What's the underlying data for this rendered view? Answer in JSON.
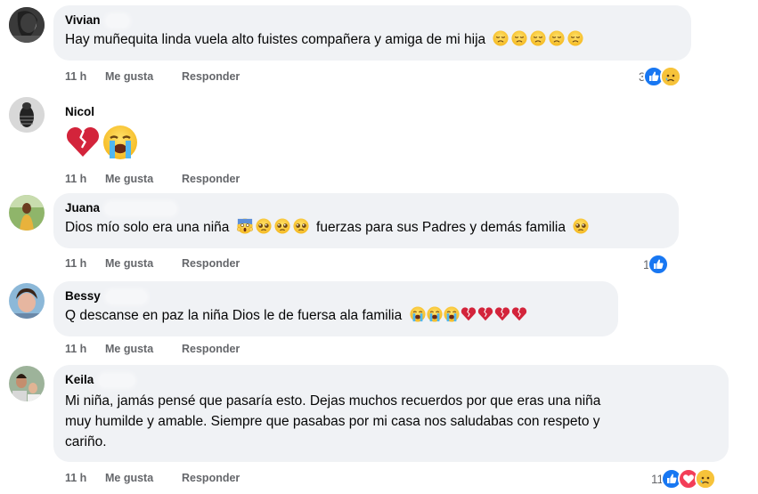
{
  "labels": {
    "like": "Me gusta",
    "reply": "Responder"
  },
  "colors": {
    "bubble": "#f0f2f5",
    "meta": "#65676b",
    "like_blue": "#1877f2",
    "love_red": "#f33e58"
  },
  "comments": [
    {
      "author": "Vivian",
      "text": "Hay muñequita linda vuela alto fuistes compañera y amiga de mi hija",
      "emojis": [
        "disappointed-face",
        "disappointed-face",
        "disappointed-face",
        "disappointed-face",
        "disappointed-face"
      ],
      "time": "11 h",
      "reaction_count": "3",
      "reactions": [
        "like-icon",
        "sad-icon"
      ]
    },
    {
      "author": "Nicol",
      "text": "",
      "emojis": [
        "broken-heart",
        "crying-face"
      ],
      "time": "11 h",
      "reaction_count": "",
      "reactions": []
    },
    {
      "author": "Juana",
      "text": "Dios mío solo era una niña",
      "text2": "fuerzas para sus Padres y demás familia",
      "emojis": [
        "screaming-face",
        "pleading-face",
        "pleading-face",
        "pleading-face"
      ],
      "emojis_end": [
        "pleading-face"
      ],
      "time": "11 h",
      "reaction_count": "1",
      "reactions": [
        "like-icon"
      ]
    },
    {
      "author": "Bessy",
      "text": "Q descanse en paz la niña Dios le de fuersa ala familia",
      "emojis": [
        "crying-face",
        "crying-face",
        "crying-face",
        "broken-heart",
        "broken-heart",
        "broken-heart",
        "broken-heart"
      ],
      "time": "11 h",
      "reaction_count": "",
      "reactions": []
    },
    {
      "author": "Keila",
      "text_lines": [
        "Mi niña, jamás pensé que pasaría esto. Dejas muchos recuerdos por que eras una niña",
        "muy humilde y amable. Siempre que pasabas por mi casa nos saludabas con respeto y",
        "cariño."
      ],
      "time": "11 h",
      "reaction_count": "11",
      "reactions": [
        "like-icon",
        "love-icon",
        "sad-icon"
      ]
    }
  ]
}
